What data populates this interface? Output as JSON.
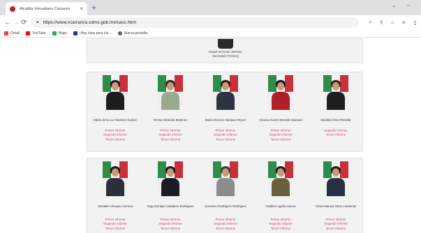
{
  "browser": {
    "tab_title": "Alcaldía Venustiano Carranza",
    "tab_close": "×",
    "new_tab": "+",
    "url": "https://www.vcarranza.cdmx.gob.mx/cavc.html",
    "window_minimize": "⌄",
    "window_restore": "–",
    "bookmarks": [
      {
        "label": "Gmail",
        "color": "#ea4335"
      },
      {
        "label": "YouTube",
        "color": "#ff0000"
      },
      {
        "label": "Maps",
        "color": "#34a853"
      },
      {
        "label": "¡Hay citas para los...",
        "color": "#1a3a8a"
      },
      {
        "label": "Nueva pestaña",
        "color": "#5f6368"
      }
    ]
  },
  "secretary": {
    "name": "Daniel Amezcán Jiménez",
    "role": "(Secretario Técnico)"
  },
  "report_links": [
    "Primer Informe",
    "Segundo Informe",
    "Tercer Informe"
  ],
  "councilors_row1": [
    {
      "name": "María de la Luz Ramírez Suárez",
      "suit": "#1c1c1c",
      "hair": "#1a1a1a",
      "links": 3
    },
    {
      "name": "Teresa Garduño Martínez",
      "suit": "#9aaa8a",
      "hair": "#3a2a20",
      "links": 3
    },
    {
      "name": "María Dolores Vázquez Reyes",
      "suit": "#2d3340",
      "hair": "#2a1a14",
      "links": 3
    },
    {
      "name": "Arianna Noemí Mondal Alvarado",
      "suit": "#b01e2a",
      "hair": "#1a1a1a",
      "links": 3
    },
    {
      "name": "Zandibel Díaz Rebollar",
      "suit": "#1e1e1e",
      "hair": "#3a2418",
      "links": 2
    }
  ],
  "councilors_row2": [
    {
      "name": "Gamaliel Vázquez Herrera",
      "suit": "#2a2f3a",
      "hair": "#1a1a1a",
      "links": 3
    },
    {
      "name": "Hugo Enrique Caballero Rodríguez",
      "suit": "#1a1d24",
      "hair": "#1a1a1a",
      "links": 3
    },
    {
      "name": "Jerónimo Rodríguez Rodríguez",
      "suit": "#8c8c8c",
      "hair": "#3a3a3a",
      "links": 3
    },
    {
      "name": "Vladimir Agaña García",
      "suit": "#6a6040",
      "hair": "#1a1a1a",
      "links": 3
    },
    {
      "name": "Víctor Manuel Otero Cárdenas",
      "suit": "#2a3044",
      "hair": "#1a1a1a",
      "links": 3
    }
  ]
}
